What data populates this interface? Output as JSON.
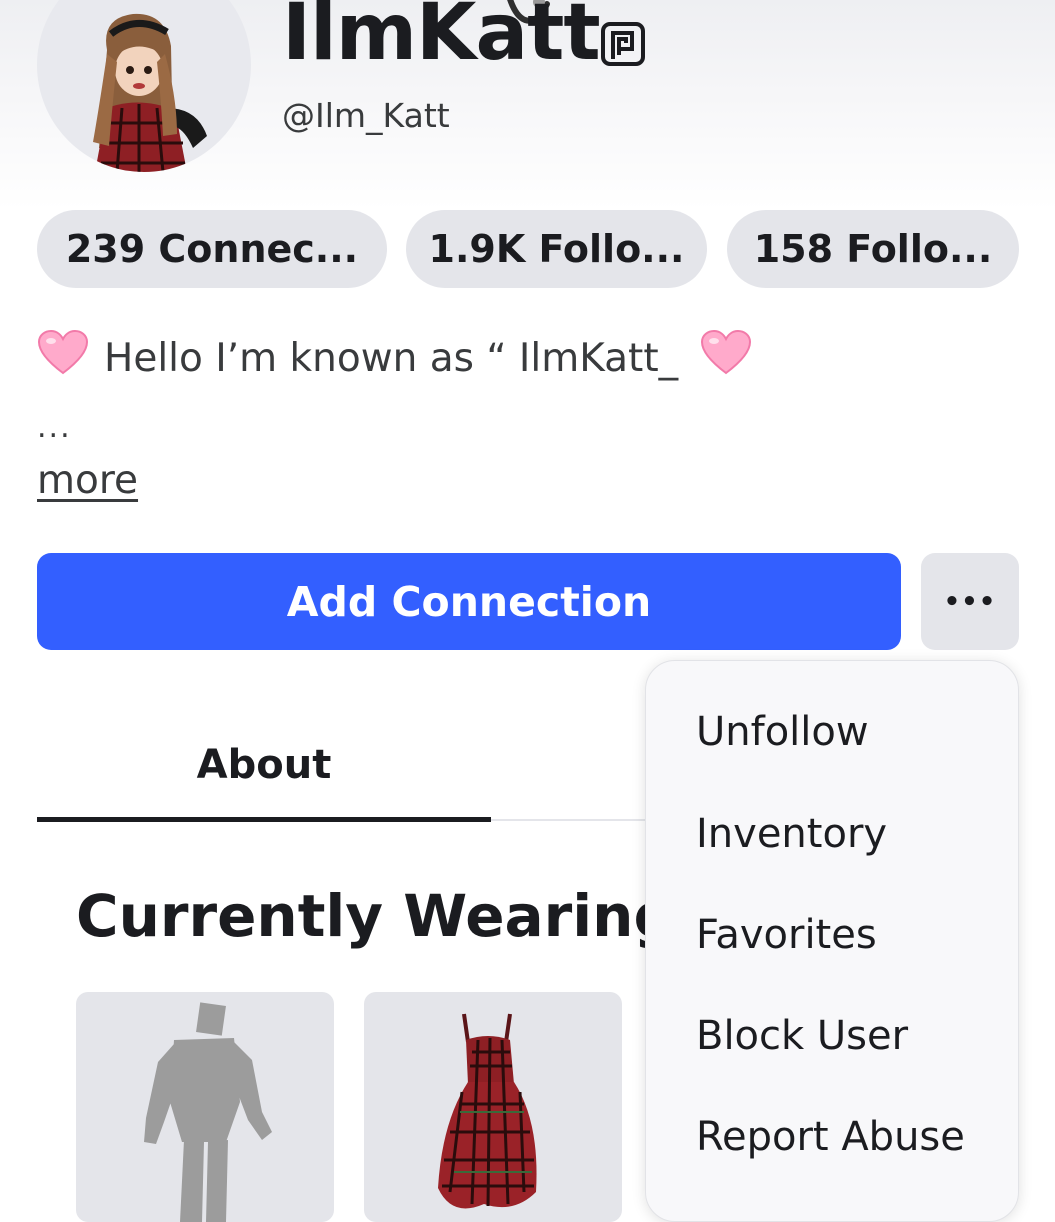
{
  "profile": {
    "display_name": "IlmKatt",
    "username": "@Ilm_Katt"
  },
  "stats": [
    {
      "label": "239 Connec..."
    },
    {
      "label": "1.9K Follo..."
    },
    {
      "label": "158 Follo..."
    }
  ],
  "bio": {
    "text": "Hello I’m known as “ IlmKatt_",
    "ellipsis": "...",
    "more_label": "more"
  },
  "actions": {
    "add_connection_label": "Add Connection",
    "more_label": "•••"
  },
  "tabs": [
    {
      "label": "About",
      "active": true
    }
  ],
  "section": {
    "title": "Currently Wearing"
  },
  "dropdown": {
    "items": [
      {
        "label": "Unfollow"
      },
      {
        "label": "Inventory"
      },
      {
        "label": "Favorites"
      },
      {
        "label": "Block User"
      },
      {
        "label": "Report Abuse"
      }
    ]
  },
  "colors": {
    "primary": "#335fff",
    "pill_bg": "#e4e5ea",
    "text": "#1b1c20"
  },
  "icons": {
    "verified": "premium-badge-icon",
    "heart": "pink-heart-emoji-icon"
  }
}
